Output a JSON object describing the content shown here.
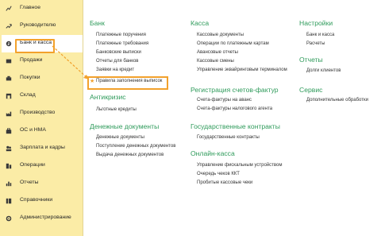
{
  "sidebar": {
    "items": [
      {
        "label": "Главное",
        "icon": "chart-line-icon"
      },
      {
        "label": "Руководителю",
        "icon": "trend-up-icon"
      },
      {
        "label": "Банк и касса",
        "icon": "bank-cash-icon"
      },
      {
        "label": "Продажи",
        "icon": "cart-icon"
      },
      {
        "label": "Покупки",
        "icon": "basket-icon"
      },
      {
        "label": "Склад",
        "icon": "warehouse-icon"
      },
      {
        "label": "Производство",
        "icon": "factory-icon"
      },
      {
        "label": "ОС и НМА",
        "icon": "assets-icon"
      },
      {
        "label": "Зарплата и кадры",
        "icon": "people-icon"
      },
      {
        "label": "Операции",
        "icon": "operations-icon"
      },
      {
        "label": "Отчеты",
        "icon": "reports-icon"
      },
      {
        "label": "Справочники",
        "icon": "books-icon"
      },
      {
        "label": "Администрирование",
        "icon": "gear-icon"
      }
    ]
  },
  "main": {
    "col1": {
      "bank_title": "Банк",
      "bank_links": [
        "Платежные поручения",
        "Платежные требования",
        "Банковские выписки",
        "Отчеты для банков",
        "Заявки на кредит",
        "Правила заполнения выписок"
      ],
      "anticrisis_title": "Антикризис",
      "anticrisis_links": [
        "Льготные кредиты"
      ],
      "money_title": "Денежные документы",
      "money_links": [
        "Денежные документы",
        "Поступление денежных документов",
        "Выдача денежных документов"
      ]
    },
    "col2": {
      "cash_title": "Касса",
      "cash_links": [
        "Кассовые документы",
        "Операции по платежным картам",
        "Авансовые отчеты",
        "Кассовые смены",
        "Управление эквайринговым терминалом"
      ],
      "invoices_title": "Регистрация счетов-фактур",
      "invoices_links": [
        "Счета-фактуры на аванс",
        "Счета-фактуры налогового агента"
      ],
      "gov_title": "Государственные контракты",
      "gov_links": [
        "Государственные контракты"
      ],
      "online_title": "Онлайн-касса",
      "online_links": [
        "Управление фискальным устройством",
        "Очередь чеков ККТ",
        "Пробитые кассовые чеки"
      ]
    },
    "col3": {
      "settings_title": "Настройки",
      "settings_links": [
        "Банк и касса",
        "Расчеты"
      ],
      "reports_title": "Отчеты",
      "reports_links": [
        "Долги клиентов"
      ],
      "service_title": "Сервис",
      "service_links": [
        "Дополнительные обработки"
      ]
    }
  },
  "colors": {
    "sidebar_bg": "#fbeca6",
    "accent": "#f2a12c",
    "section_title": "#2f9b5b"
  }
}
